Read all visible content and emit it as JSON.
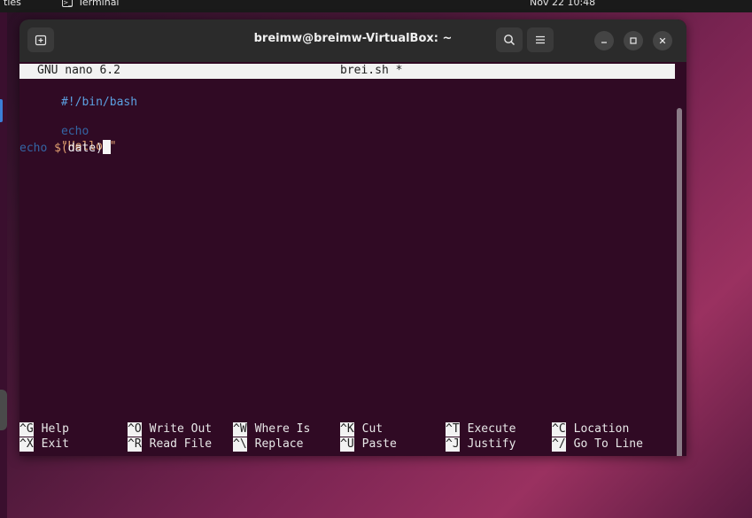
{
  "topbar": {
    "activities_label": "ties",
    "app_name": "Terminal",
    "clock": "Nov 22  10:48"
  },
  "window": {
    "title": "breimw@breimw-VirtualBox: ~"
  },
  "nano": {
    "version": "GNU nano 6.2",
    "filename": "brei.sh *"
  },
  "code": {
    "line1": "#!/bin/bash",
    "line2_kw": "echo",
    "line2_str": "\"Hello.\"",
    "line3_kw": "echo",
    "line3_sym": "$(",
    "line3_plain": "date",
    "line3_close": ")"
  },
  "shortcuts": [
    {
      "key": "^G",
      "label": "Help"
    },
    {
      "key": "^O",
      "label": "Write Out"
    },
    {
      "key": "^W",
      "label": "Where Is"
    },
    {
      "key": "^K",
      "label": "Cut"
    },
    {
      "key": "^T",
      "label": "Execute"
    },
    {
      "key": "^C",
      "label": "Location"
    },
    {
      "key": "^X",
      "label": "Exit"
    },
    {
      "key": "^R",
      "label": "Read File"
    },
    {
      "key": "^\\",
      "label": "Replace"
    },
    {
      "key": "^U",
      "label": "Paste"
    },
    {
      "key": "^J",
      "label": "Justify"
    },
    {
      "key": "^/",
      "label": "Go To Line"
    }
  ],
  "colors": {
    "terminal_bg": "#300a24",
    "titlebar_bg": "#2b2b2b",
    "keyword": "#3465a4",
    "string": "#e0a070"
  },
  "icons": {
    "new_tab": "new-tab-icon",
    "search": "search-icon",
    "menu": "hamburger-menu-icon",
    "minimize": "minimize-icon",
    "maximize": "maximize-icon",
    "close": "close-icon"
  }
}
